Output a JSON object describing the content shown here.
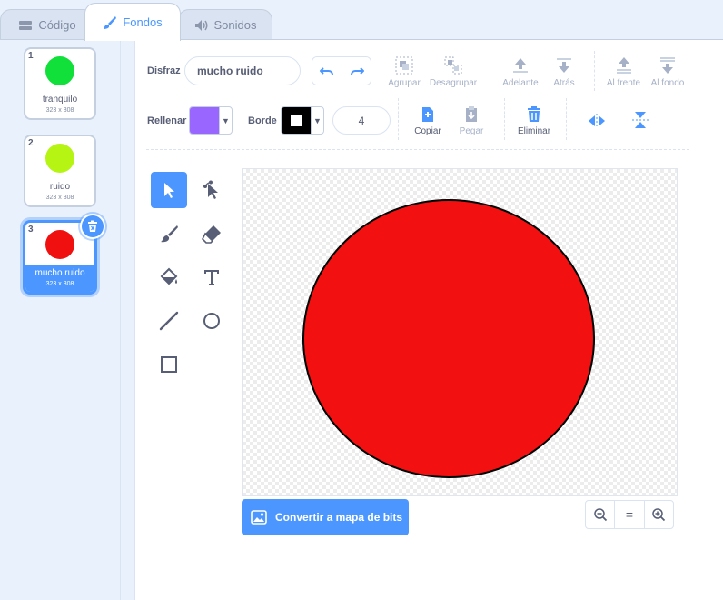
{
  "tabs": [
    {
      "label": "Código",
      "icon": "code-icon"
    },
    {
      "label": "Fondos",
      "icon": "brush-icon"
    },
    {
      "label": "Sonidos",
      "icon": "speaker-icon"
    }
  ],
  "costumes": [
    {
      "number": "1",
      "name": "tranquilo",
      "size": "323 x 308",
      "color": "#11e03a"
    },
    {
      "number": "2",
      "name": "ruido",
      "size": "323 x 308",
      "color": "#b5f413"
    },
    {
      "number": "3",
      "name": "mucho ruido",
      "size": "323 x 308",
      "color": "#f01010"
    }
  ],
  "toolbar": {
    "costume_label": "Disfraz",
    "costume_name": "mucho ruido",
    "group": "Agrupar",
    "ungroup": "Desagrupar",
    "forward": "Adelante",
    "backward": "Atrás",
    "front": "Al frente",
    "back": "Al fondo",
    "fill_label": "Rellenar",
    "fill_color": "#9966ff",
    "outline_label": "Borde",
    "outline_color": "#000000",
    "outline_width": "4",
    "copy": "Copiar",
    "paste": "Pegar",
    "delete": "Eliminar"
  },
  "canvas": {
    "shape_fill": "#f21010",
    "shape_stroke": "#000000"
  },
  "footer": {
    "convert": "Convertir a mapa de bits",
    "zoom_reset": "="
  },
  "colors": {
    "accent": "#4c97ff",
    "text": "#575e75",
    "disabled": "#a6b1c7"
  }
}
